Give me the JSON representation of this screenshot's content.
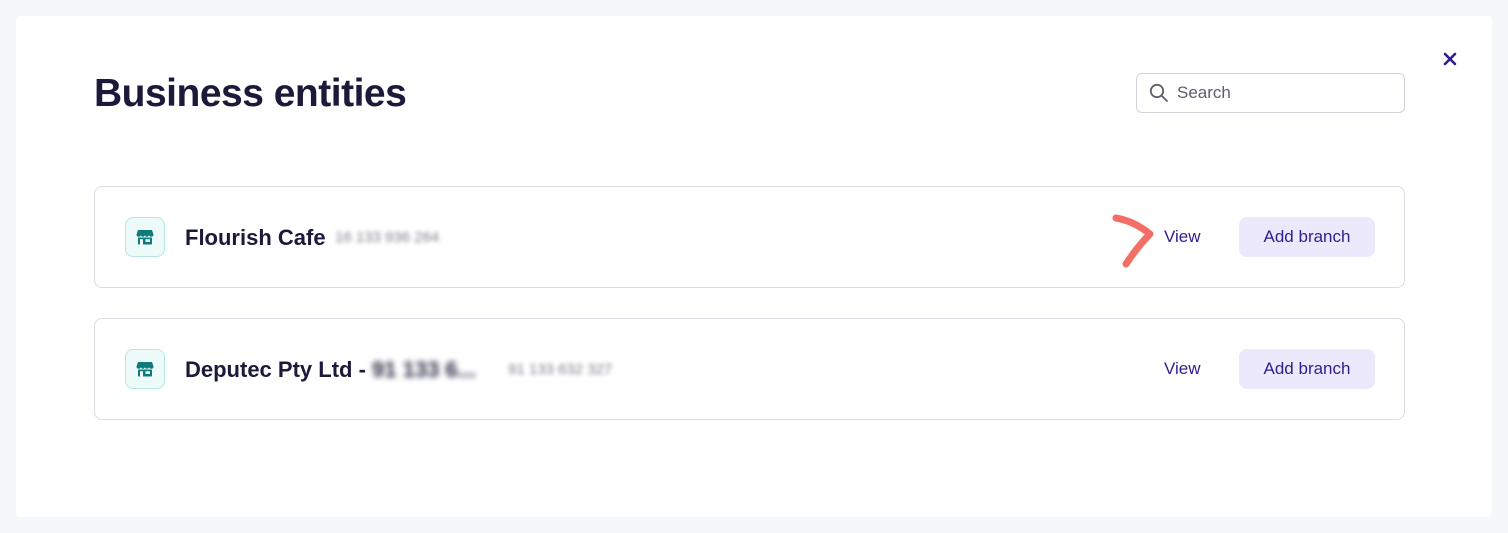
{
  "header": {
    "title": "Business entities",
    "search_placeholder": "Search",
    "close_icon": "close-icon"
  },
  "entities": [
    {
      "name": "Flourish Cafe",
      "name_blurred_suffix": "",
      "abn_blurred": "16 133 936 264",
      "view_label": "View",
      "add_branch_label": "Add branch",
      "icon": "store-icon"
    },
    {
      "name": "Deputec Pty Ltd - ",
      "name_blurred_suffix": "91 133 6...",
      "abn_blurred": "91 133 632 327",
      "view_label": "View",
      "add_branch_label": "Add branch",
      "icon": "store-icon"
    }
  ],
  "annotations": {
    "color": "#f36f66"
  },
  "colors": {
    "accent": "#2c1f8f",
    "button_bg": "#ebe9fb",
    "title": "#1b1a3a",
    "icon_teal": "#0e7a7a"
  }
}
